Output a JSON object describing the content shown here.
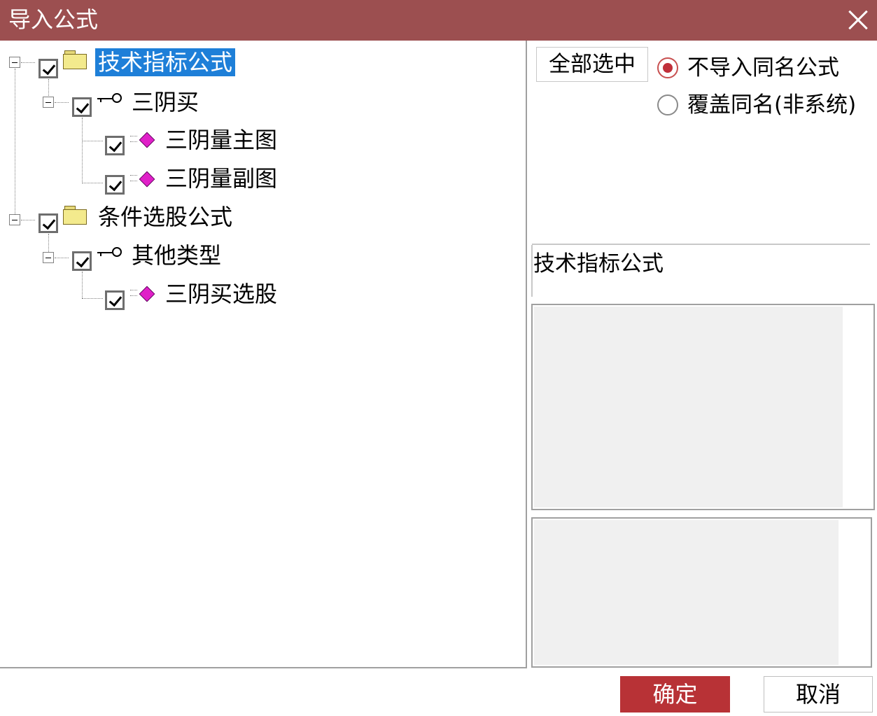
{
  "window": {
    "title": "导入公式"
  },
  "tree": {
    "root1": {
      "label": "技术指标公式",
      "checked": true,
      "expanded": true,
      "group": {
        "label": "三阴买",
        "checked": true,
        "expanded": true,
        "items": [
          {
            "label": "三阴量主图",
            "checked": true
          },
          {
            "label": "三阴量副图",
            "checked": true
          }
        ]
      }
    },
    "root2": {
      "label": "条件选股公式",
      "checked": true,
      "expanded": true,
      "group": {
        "label": "其他类型",
        "checked": true,
        "expanded": true,
        "items": [
          {
            "label": "三阴买选股",
            "checked": true
          }
        ]
      }
    }
  },
  "options": {
    "select_all_label": "全部选中",
    "radio_no_import_label": "不导入同名公式",
    "radio_overwrite_label": "覆盖同名(非系统)",
    "selected_radio": "不导入同名公式"
  },
  "info": {
    "selected_text": "技术指标公式"
  },
  "buttons": {
    "ok_label": "确定",
    "cancel_label": "取消"
  },
  "colors": {
    "titlebar": "#9c4f50",
    "selection": "#1e7fd8",
    "ok_button": "#b83236",
    "radio_on": "#c0303a"
  }
}
